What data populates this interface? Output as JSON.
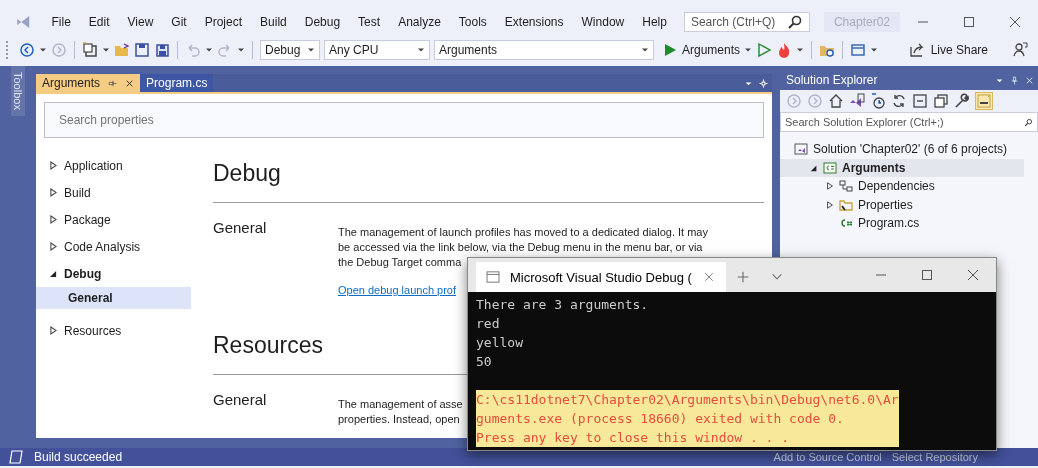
{
  "menu_bar": {
    "items": [
      "File",
      "Edit",
      "View",
      "Git",
      "Project",
      "Build",
      "Debug",
      "Test",
      "Analyze",
      "Tools",
      "Extensions",
      "Window",
      "Help"
    ],
    "search": {
      "placeholder": "Search (Ctrl+Q)"
    },
    "solution_name": "Chapter02"
  },
  "toolbar": {
    "configuration": "Debug",
    "platform": "Any CPU",
    "startup_project": "Arguments",
    "run_label": "Arguments",
    "live_share": "Live Share"
  },
  "toolbox_label": "Toolbox",
  "document_tabs": [
    {
      "label": "Arguments",
      "selected": true
    },
    {
      "label": "Program.cs",
      "selected": false
    }
  ],
  "properties": {
    "search": {
      "placeholder": "Search properties"
    },
    "nav": [
      {
        "label": "Application",
        "expanded": false,
        "selected": false
      },
      {
        "label": "Build",
        "expanded": false,
        "selected": false
      },
      {
        "label": "Package",
        "expanded": false,
        "selected": false
      },
      {
        "label": "Code Analysis",
        "expanded": false,
        "selected": false
      },
      {
        "label": "Debug",
        "expanded": true,
        "selected": false,
        "children": [
          {
            "label": "General",
            "selected": true
          }
        ]
      },
      {
        "label": "Resources",
        "expanded": false,
        "selected": false
      }
    ],
    "sections": [
      {
        "title": "Debug",
        "groups": [
          {
            "heading": "General",
            "lines": [
              "The management of launch profiles has moved to a dedicated dialog. It may",
              "be accessed via the link below, via the Debug menu in the menu bar, or via",
              "the Debug Target comma"
            ],
            "link": "Open debug launch prof"
          }
        ]
      },
      {
        "title": "Resources",
        "groups": [
          {
            "heading": "General",
            "lines": [
              "The management of asse",
              "properties. Instead, open"
            ]
          }
        ]
      }
    ]
  },
  "solution_explorer": {
    "title": "Solution Explorer",
    "search": {
      "placeholder": "Search Solution Explorer (Ctrl+;)"
    },
    "tree": [
      {
        "label": "Solution 'Chapter02' (6 of 6 projects)",
        "kind": "solution",
        "selected": false,
        "children": [
          {
            "label": "Arguments",
            "kind": "project",
            "expanded": true,
            "selected": true,
            "children": [
              {
                "label": "Dependencies",
                "kind": "dependencies",
                "expanded": false,
                "selected": false
              },
              {
                "label": "Properties",
                "kind": "folder",
                "expanded": false,
                "selected": false
              },
              {
                "label": "Program.cs",
                "kind": "csharp",
                "selected": false
              }
            ]
          }
        ]
      }
    ]
  },
  "status_bar": {
    "message": "Build succeeded",
    "items": [
      "Add to Source Control",
      "Select Repository"
    ]
  },
  "console": {
    "title": "Microsoft Visual Studio Debug (",
    "output": [
      "There are 3 arguments.",
      "red",
      "yellow",
      "50"
    ],
    "exit_message": [
      "C:\\cs11dotnet7\\Chapter02\\Arguments\\bin\\Debug\\net6.0\\Ar",
      "guments.exe (process 18660) exited with code 0.",
      "Press any key to close this window . . ."
    ]
  }
}
